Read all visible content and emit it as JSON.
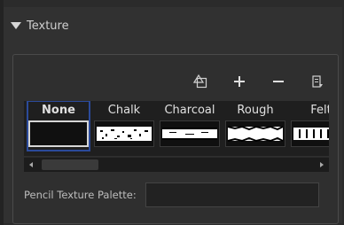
{
  "panel": {
    "title": "Texture"
  },
  "toolbar": {
    "icons": [
      "copy-texture-icon",
      "add-icon",
      "remove-icon",
      "menu-icon"
    ]
  },
  "textures": [
    {
      "label": "None",
      "selected": true
    },
    {
      "label": "Chalk",
      "selected": false
    },
    {
      "label": "Charcoal",
      "selected": false
    },
    {
      "label": "Rough",
      "selected": false
    },
    {
      "label": "Felt",
      "selected": false
    }
  ],
  "palette": {
    "label": "Pencil Texture Palette:",
    "value": ""
  },
  "colors": {
    "selection": "#2b4a9a",
    "panel_bg": "#313131"
  }
}
